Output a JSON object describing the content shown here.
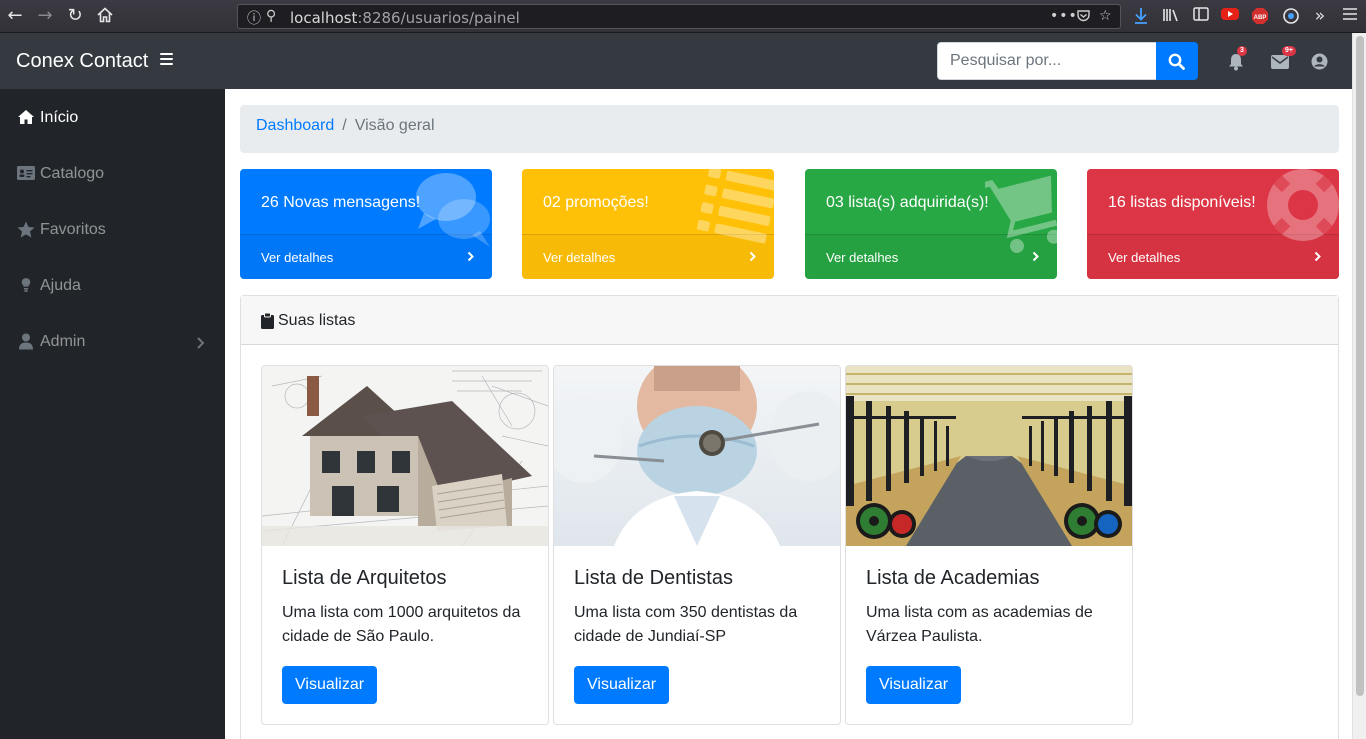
{
  "browser": {
    "url_host": "localhost",
    "url_rest": ":8286/usuarios/painel"
  },
  "app": {
    "brand": "Conex Contact"
  },
  "search": {
    "placeholder": "Pesquisar por..."
  },
  "notifications": {
    "alerts_badge": "3",
    "messages_badge": "9+"
  },
  "sidebar": {
    "items": [
      {
        "label": "Início",
        "icon": "home-icon",
        "active": true
      },
      {
        "label": "Catalogo",
        "icon": "id-card-icon",
        "active": false
      },
      {
        "label": "Favoritos",
        "icon": "star-icon",
        "active": false
      },
      {
        "label": "Ajuda",
        "icon": "lightbulb-icon",
        "active": false
      },
      {
        "label": "Admin",
        "icon": "user-icon",
        "active": false
      }
    ]
  },
  "breadcrumb": {
    "link": "Dashboard",
    "separator": "/",
    "current": "Visão geral"
  },
  "stats": [
    {
      "text": "26 Novas mensagens!",
      "footer": "Ver detalhes",
      "color": "#007bff",
      "icon": "comments-icon"
    },
    {
      "text": "02 promoções!",
      "footer": "Ver detalhes",
      "color": "#ffc107",
      "icon": "list-icon"
    },
    {
      "text": "03 lista(s) adquirida(s)!",
      "footer": "Ver detalhes",
      "color": "#28a745",
      "icon": "shopping-cart-icon"
    },
    {
      "text": "16 listas disponíveis!",
      "footer": "Ver detalhes",
      "color": "#dc3545",
      "icon": "life-ring-icon"
    }
  ],
  "lists": {
    "header": "Suas listas",
    "items": [
      {
        "title": "Lista de Arquitetos",
        "text": "Uma lista com 1000 arquitetos da cidade de São Paulo.",
        "button": "Visualizar",
        "image": "house-blueprint-photo"
      },
      {
        "title": "Lista de Dentistas",
        "text": "Uma lista com 350 dentistas da cidade de Jundiaí-SP",
        "button": "Visualizar",
        "image": "dentist-photo"
      },
      {
        "title": "Lista de Academias",
        "text": "Uma lista com as academias de Várzea Paulista.",
        "button": "Visualizar",
        "image": "gym-photo"
      }
    ]
  }
}
